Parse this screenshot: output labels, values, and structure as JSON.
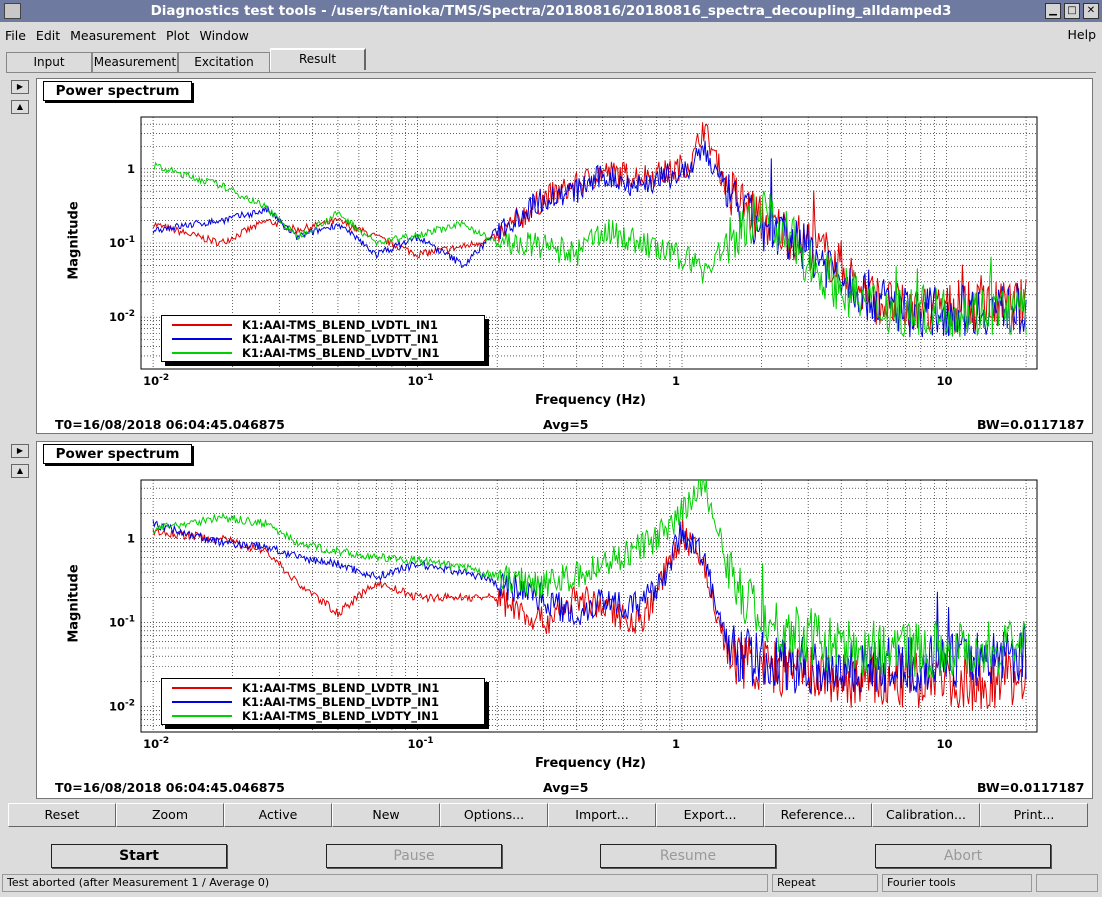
{
  "window": {
    "title": "Diagnostics test tools - /users/tanioka/TMS/Spectra/20180816/20180816_spectra_decoupling_alldamped3"
  },
  "menu": {
    "items": [
      "File",
      "Edit",
      "Measurement",
      "Plot",
      "Window"
    ],
    "help": "Help"
  },
  "tabs": [
    {
      "label": "Input",
      "active": false
    },
    {
      "label": "Measurement",
      "active": false
    },
    {
      "label": "Excitation",
      "active": false
    },
    {
      "label": "Result",
      "active": true
    }
  ],
  "plots": [
    {
      "label": "Power spectrum",
      "ylabel": "Magnitude",
      "xlabel": "Frequency (Hz)",
      "xticks": [
        "10",
        "10",
        "1",
        "10"
      ],
      "xtick_exp": [
        "-2",
        "-1",
        "",
        ""
      ],
      "yticks": [
        "1",
        "10",
        "10"
      ],
      "ytick_exp": [
        "",
        "-1",
        "-2"
      ],
      "t0": "T0=16/08/2018 06:04:45.046875",
      "avg": "Avg=5",
      "bw": "BW=0.0117187",
      "legend": [
        {
          "name": "K1:AAI-TMS_BLEND_LVDTL_IN1",
          "color": "#e00000"
        },
        {
          "name": "K1:AAI-TMS_BLEND_LVDTT_IN1",
          "color": "#0000e0"
        },
        {
          "name": "K1:AAI-TMS_BLEND_LVDTV_IN1",
          "color": "#00d000"
        }
      ]
    },
    {
      "label": "Power spectrum",
      "ylabel": "Magnitude",
      "xlabel": "Frequency (Hz)",
      "xticks": [
        "10",
        "10",
        "1",
        "10"
      ],
      "xtick_exp": [
        "-2",
        "-1",
        "",
        ""
      ],
      "yticks": [
        "1",
        "10",
        "10"
      ],
      "ytick_exp": [
        "",
        "-1",
        "-2"
      ],
      "t0": "T0=16/08/2018 06:04:45.046875",
      "avg": "Avg=5",
      "bw": "BW=0.0117187",
      "legend": [
        {
          "name": "K1:AAI-TMS_BLEND_LVDTR_IN1",
          "color": "#e00000"
        },
        {
          "name": "K1:AAI-TMS_BLEND_LVDTP_IN1",
          "color": "#0000e0"
        },
        {
          "name": "K1:AAI-TMS_BLEND_LVDTY_IN1",
          "color": "#00d000"
        }
      ]
    }
  ],
  "toolbar": [
    "Reset",
    "Zoom",
    "Active",
    "New",
    "Options...",
    "Import...",
    "Export...",
    "Reference...",
    "Calibration...",
    "Print..."
  ],
  "actions": [
    {
      "label": "Start",
      "enabled": true
    },
    {
      "label": "Pause",
      "enabled": false
    },
    {
      "label": "Resume",
      "enabled": false
    },
    {
      "label": "Abort",
      "enabled": false
    }
  ],
  "status": {
    "message": "Test aborted (after Measurement 1 / Average 0)",
    "mode": "Repeat",
    "tool": "Fourier tools"
  },
  "chart_data": [
    {
      "type": "line",
      "title": "Power spectrum",
      "xlabel": "Frequency (Hz)",
      "ylabel": "Magnitude",
      "xscale": "log",
      "yscale": "log",
      "xlim": [
        0.009,
        22
      ],
      "ylim": [
        0.002,
        5
      ],
      "grid": true,
      "legend_position": "bottom-left",
      "series": [
        {
          "name": "K1:AAI-TMS_BLEND_LVDTL_IN1",
          "color": "#e00000",
          "x": [
            0.01,
            0.018,
            0.027,
            0.035,
            0.05,
            0.07,
            0.1,
            0.15,
            0.2,
            0.3,
            0.4,
            0.5,
            0.7,
            0.9,
            1.1,
            1.2,
            1.5,
            2,
            3,
            4,
            5,
            7,
            10,
            15,
            20
          ],
          "y": [
            0.18,
            0.1,
            0.2,
            0.15,
            0.2,
            0.12,
            0.07,
            0.09,
            0.12,
            0.4,
            0.6,
            0.9,
            0.8,
            0.9,
            1.3,
            3.8,
            0.5,
            0.2,
            0.1,
            0.05,
            0.02,
            0.012,
            0.013,
            0.014,
            0.015
          ]
        },
        {
          "name": "K1:AAI-TMS_BLEND_LVDTT_IN1",
          "color": "#0000e0",
          "x": [
            0.01,
            0.018,
            0.027,
            0.035,
            0.05,
            0.07,
            0.1,
            0.15,
            0.2,
            0.3,
            0.4,
            0.5,
            0.7,
            0.9,
            1.1,
            1.2,
            1.5,
            2,
            3,
            4,
            5,
            7,
            10,
            15,
            20
          ],
          "y": [
            0.15,
            0.2,
            0.28,
            0.12,
            0.18,
            0.07,
            0.12,
            0.05,
            0.15,
            0.4,
            0.5,
            0.8,
            0.6,
            0.8,
            1.0,
            2.0,
            0.4,
            0.15,
            0.08,
            0.04,
            0.02,
            0.012,
            0.012,
            0.013,
            0.013
          ]
        },
        {
          "name": "K1:AAI-TMS_BLEND_LVDTV_IN1",
          "color": "#00d000",
          "x": [
            0.01,
            0.018,
            0.027,
            0.035,
            0.05,
            0.07,
            0.1,
            0.15,
            0.2,
            0.3,
            0.4,
            0.5,
            0.7,
            0.9,
            1.1,
            1.2,
            1.5,
            2,
            3,
            4,
            5,
            7,
            10,
            15,
            20
          ],
          "y": [
            1.1,
            0.6,
            0.3,
            0.12,
            0.25,
            0.1,
            0.13,
            0.18,
            0.1,
            0.09,
            0.07,
            0.15,
            0.1,
            0.07,
            0.06,
            0.04,
            0.1,
            0.3,
            0.06,
            0.025,
            0.015,
            0.012,
            0.012,
            0.012,
            0.012
          ]
        }
      ]
    },
    {
      "type": "line",
      "title": "Power spectrum",
      "xlabel": "Frequency (Hz)",
      "ylabel": "Magnitude",
      "xscale": "log",
      "yscale": "log",
      "xlim": [
        0.009,
        22
      ],
      "ylim": [
        0.005,
        5
      ],
      "grid": true,
      "legend_position": "bottom-left",
      "series": [
        {
          "name": "K1:AAI-TMS_BLEND_LVDTR_IN1",
          "color": "#e00000",
          "x": [
            0.01,
            0.018,
            0.027,
            0.035,
            0.05,
            0.07,
            0.1,
            0.15,
            0.2,
            0.3,
            0.4,
            0.5,
            0.7,
            0.9,
            1.0,
            1.2,
            1.5,
            2,
            3,
            4,
            5,
            7,
            10,
            15,
            20
          ],
          "y": [
            1.2,
            1.0,
            0.7,
            0.3,
            0.13,
            0.3,
            0.2,
            0.2,
            0.2,
            0.1,
            0.2,
            0.15,
            0.1,
            0.5,
            1.2,
            0.5,
            0.04,
            0.03,
            0.025,
            0.02,
            0.02,
            0.02,
            0.02,
            0.02,
            0.025
          ]
        },
        {
          "name": "K1:AAI-TMS_BLEND_LVDTP_IN1",
          "color": "#0000e0",
          "x": [
            0.01,
            0.018,
            0.027,
            0.035,
            0.05,
            0.07,
            0.1,
            0.15,
            0.2,
            0.3,
            0.4,
            0.5,
            0.7,
            0.9,
            1.0,
            1.2,
            1.5,
            2,
            3,
            4,
            5,
            7,
            10,
            15,
            20
          ],
          "y": [
            1.5,
            0.9,
            0.8,
            0.6,
            0.5,
            0.35,
            0.5,
            0.4,
            0.3,
            0.2,
            0.12,
            0.2,
            0.15,
            0.5,
            1.3,
            0.6,
            0.05,
            0.035,
            0.03,
            0.03,
            0.03,
            0.03,
            0.035,
            0.04,
            0.045
          ]
        },
        {
          "name": "K1:AAI-TMS_BLEND_LVDTY_IN1",
          "color": "#00d000",
          "x": [
            0.01,
            0.018,
            0.027,
            0.035,
            0.05,
            0.07,
            0.1,
            0.15,
            0.2,
            0.3,
            0.4,
            0.5,
            0.7,
            0.9,
            1.0,
            1.2,
            1.5,
            2,
            3,
            4,
            5,
            7,
            10,
            15,
            20
          ],
          "y": [
            1.3,
            1.8,
            1.5,
            0.9,
            0.7,
            0.6,
            0.55,
            0.45,
            0.35,
            0.3,
            0.35,
            0.5,
            0.8,
            1.3,
            2.0,
            5.0,
            0.4,
            0.1,
            0.07,
            0.05,
            0.05,
            0.05,
            0.05,
            0.05,
            0.05
          ]
        }
      ]
    }
  ]
}
